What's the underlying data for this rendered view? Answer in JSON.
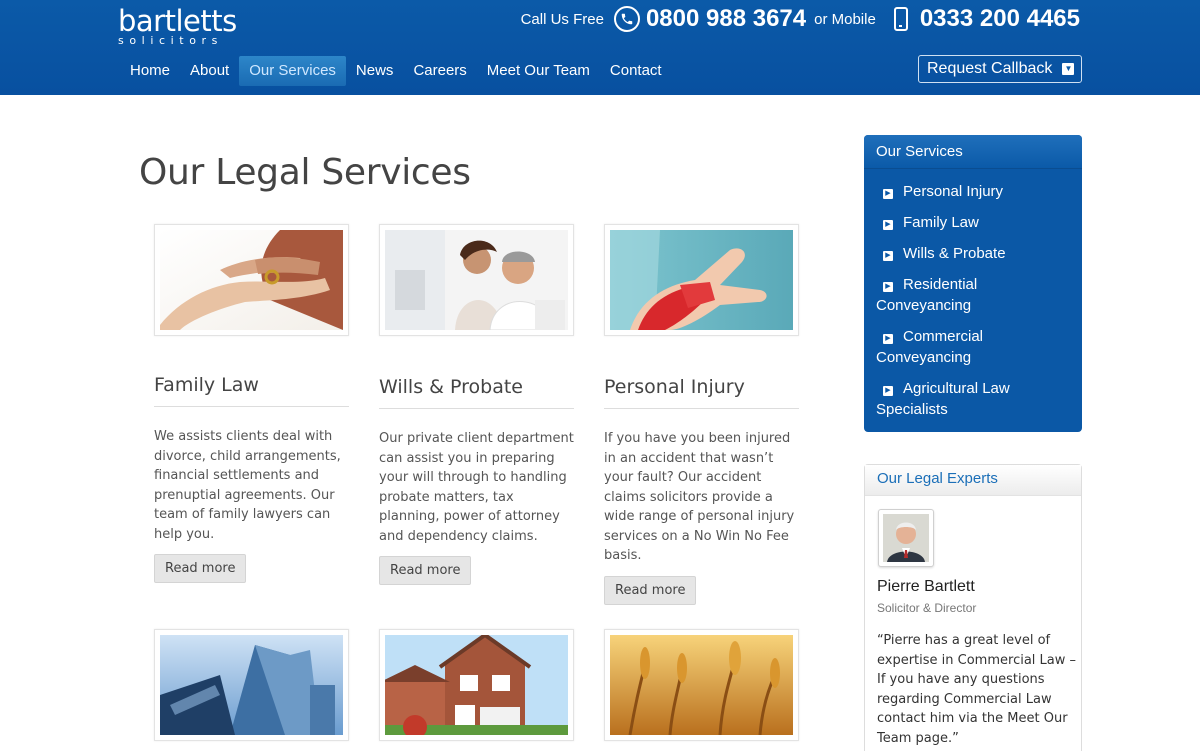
{
  "header": {
    "logo_main": "bartletts",
    "logo_sub": "solicitors",
    "call_label": "Call Us Free",
    "phone_free": "0800 988 3674",
    "mobile_label": "or Mobile",
    "phone_mobile": "0333 200 4465",
    "callback_label": "Request Callback"
  },
  "nav": {
    "items": [
      "Home",
      "About",
      "Our Services",
      "News",
      "Careers",
      "Meet Our Team",
      "Contact"
    ],
    "active": "Our Services"
  },
  "main": {
    "title": "Our Legal Services",
    "cards": [
      {
        "title": "Family Law",
        "description": "We assists clients deal with divorce, child arrangements, financial settlements and prenuptial agreements. Our team of family lawyers can help you.",
        "button": "Read more"
      },
      {
        "title": "Wills & Probate",
        "description": "Our private client department can assist you in preparing your will through to handling probate matters, tax planning, power of attorney and dependency claims.",
        "button": "Read more"
      },
      {
        "title": "Personal Injury",
        "description": "If you have you been injured in an accident that wasn’t your fault? Our accident claims solicitors provide a wide range of personal injury services on a No Win No Fee basis.",
        "button": "Read more"
      }
    ]
  },
  "sidebar": {
    "services_title": "Our Services",
    "services": [
      "Personal Injury",
      "Family Law",
      "Wills & Probate",
      "Residential Conveyancing",
      "Commercial Conveyancing",
      "Agricultural Law Specialists"
    ],
    "experts_title": "Our Legal Experts",
    "expert": {
      "name": "Pierre Bartlett",
      "role": "Solicitor & Director",
      "quote": "“Pierre has a great level of expertise in Commercial Law – If you have any questions regarding Commercial Law contact him via the Meet Our Team page.”"
    }
  },
  "icons": {
    "phone": "phone-icon",
    "mobile": "mobile-icon",
    "callback_arrow": "caret-down-icon",
    "bullet": "triangle-right-icon"
  },
  "colors": {
    "brand_blue": "#0b5aa8",
    "active_tab": "#2d86c9",
    "link_blue": "#1b6fb8"
  }
}
